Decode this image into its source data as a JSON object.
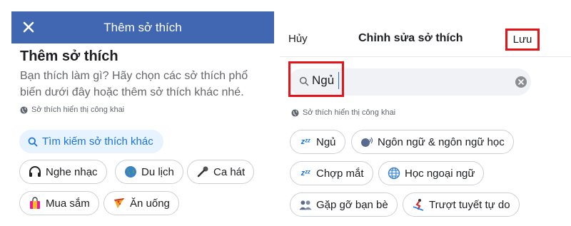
{
  "left": {
    "title": "Thêm sở thích",
    "heading": "Thêm sở thích",
    "description": "Bạn thích làm gì? Hãy chọn các sở thích phổ biến dưới đây hoặc thêm sở thích khác nhé.",
    "privacy": "Sở thích hiển thị công khai",
    "search_other": "Tìm kiếm sở thích khác",
    "hobbies": [
      {
        "label": "Nghe nhạc",
        "icon": "headphones-icon"
      },
      {
        "label": "Du lịch",
        "icon": "globe-icon"
      },
      {
        "label": "Ca hát",
        "icon": "microphone-icon"
      },
      {
        "label": "Mua sắm",
        "icon": "shopping-bag-icon"
      },
      {
        "label": "Ăn uống",
        "icon": "pizza-icon"
      }
    ]
  },
  "right": {
    "cancel": "Hủy",
    "title": "Chỉnh sửa sở thích",
    "save": "Lưu",
    "search_value": "Ngủ",
    "privacy": "Sở thích hiển thị công khai",
    "hobbies": [
      {
        "label": "Ngủ",
        "icon": "sleep-zz-icon"
      },
      {
        "label": "Ngôn ngữ & ngôn ngữ học",
        "icon": "speaking-head-icon"
      },
      {
        "label": "Chợp mắt",
        "icon": "sleep-zz-icon"
      },
      {
        "label": "Học ngoại ngữ",
        "icon": "globe-grid-icon"
      },
      {
        "label": "Gặp gỡ bạn bè",
        "icon": "people-icon"
      },
      {
        "label": "Trượt tuyết tự do",
        "icon": "skier-icon"
      }
    ]
  },
  "colors": {
    "header_blue": "#4267b2",
    "link_blue": "#1b74e4",
    "highlight_red": "#e4141b"
  }
}
